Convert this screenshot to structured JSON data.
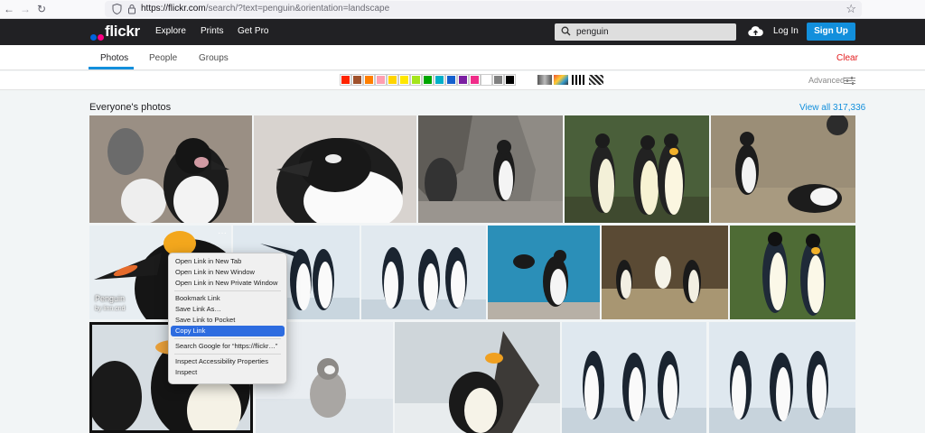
{
  "browser": {
    "url_host": "https://flickr.com",
    "url_rest": "/search/?text=penguin&orientation=landscape"
  },
  "header": {
    "logo": "flickr",
    "nav": [
      "Explore",
      "Prints",
      "Get Pro"
    ],
    "search_value": "penguin",
    "login": "Log In",
    "signup": "Sign Up"
  },
  "subnav": {
    "tabs": [
      "Photos",
      "People",
      "Groups"
    ],
    "clear": "Clear"
  },
  "filters": {
    "colors": [
      "#ff2400",
      "#a0522d",
      "#ff7f00",
      "#ff9fb1",
      "#ffd400",
      "#ffe700",
      "#a5e51c",
      "#00a600",
      "#00afc8",
      "#1560ce",
      "#7b1fa2",
      "#f02c89",
      "#ffffff",
      "#808080",
      "#000000"
    ],
    "advanced": "Advanced"
  },
  "section": {
    "title": "Everyone's photos",
    "view_all": "View all 317,336"
  },
  "hovered_photo": {
    "title": "Penguin",
    "by": "by linn.cnd",
    "more": "···"
  },
  "context_menu": {
    "items": [
      "Open Link in New Tab",
      "Open Link in New Window",
      "Open Link in New Private Window",
      "Bookmark Link",
      "Save Link As…",
      "Save Link to Pocket",
      "Copy Link",
      "Search Google for “https://flickr…”",
      "Inspect Accessibility Properties",
      "Inspect"
    ]
  }
}
